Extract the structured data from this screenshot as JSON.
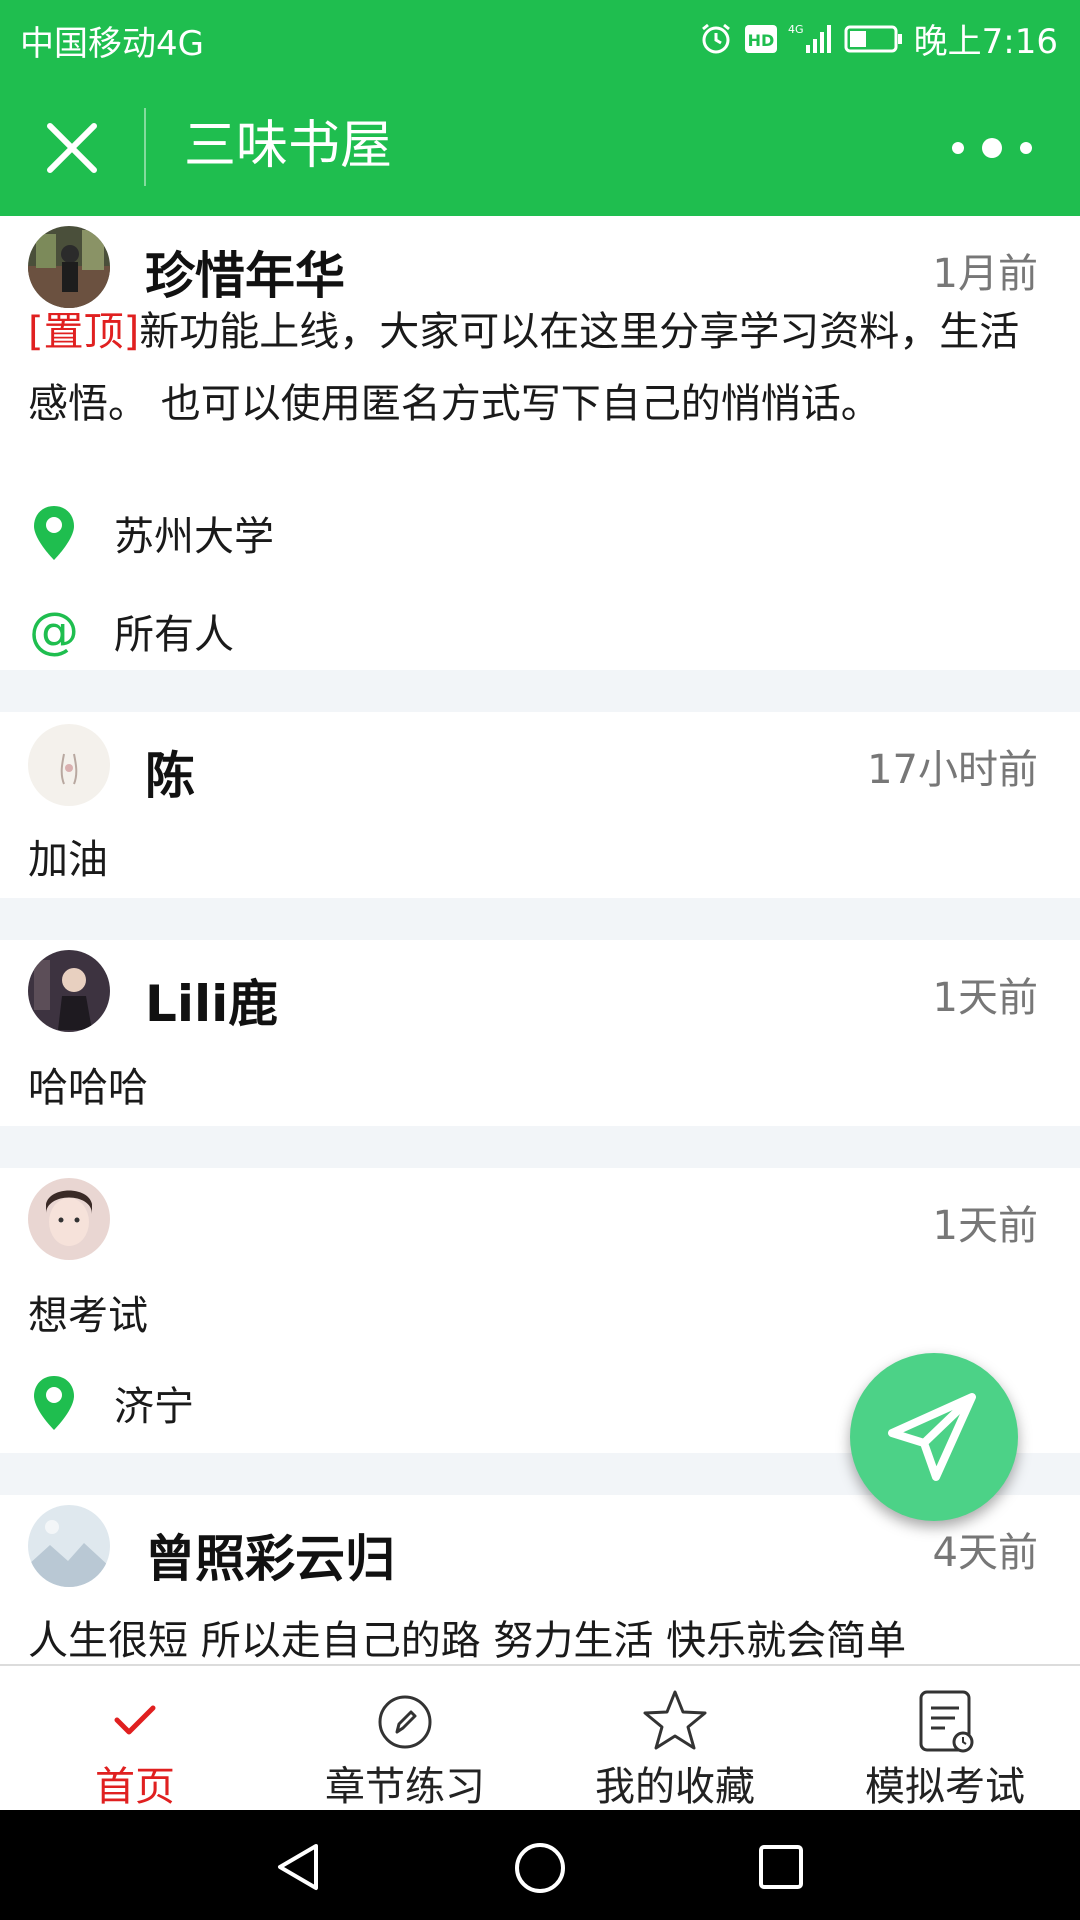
{
  "status_bar": {
    "carrier": "中国移动4G",
    "time": "晚上7:16"
  },
  "nav": {
    "title": "三味书屋"
  },
  "posts": [
    {
      "name": "珍惜年华",
      "time": "1月前",
      "pinned_tag": "[置顶]",
      "content": "新功能上线，大家可以在这里分享学习资料，生活感悟。 也可以使用匿名方式写下自己的悄悄话。",
      "location": "苏州大学",
      "mention": "所有人"
    },
    {
      "name": "陈",
      "time": "17小时前",
      "content": "加油"
    },
    {
      "name": "Lili鹿",
      "time": "1天前",
      "content": "哈哈哈"
    },
    {
      "name": "",
      "time": "1天前",
      "content": "想考试",
      "location": "济宁"
    },
    {
      "name": "曾照彩云归",
      "time": "4天前",
      "content": "人生很短 所以走自己的路 努力生活 快乐就会简单"
    }
  ],
  "tabs": [
    {
      "label": "首页",
      "icon": "check-icon",
      "active": true
    },
    {
      "label": "章节练习",
      "icon": "pencil-icon",
      "active": false
    },
    {
      "label": "我的收藏",
      "icon": "star-icon",
      "active": false
    },
    {
      "label": "模拟考试",
      "icon": "exam-icon",
      "active": false
    }
  ],
  "colors": {
    "brand_green": "#1fbe4f",
    "active_red": "#e02020",
    "fab_green": "#4cd287"
  }
}
